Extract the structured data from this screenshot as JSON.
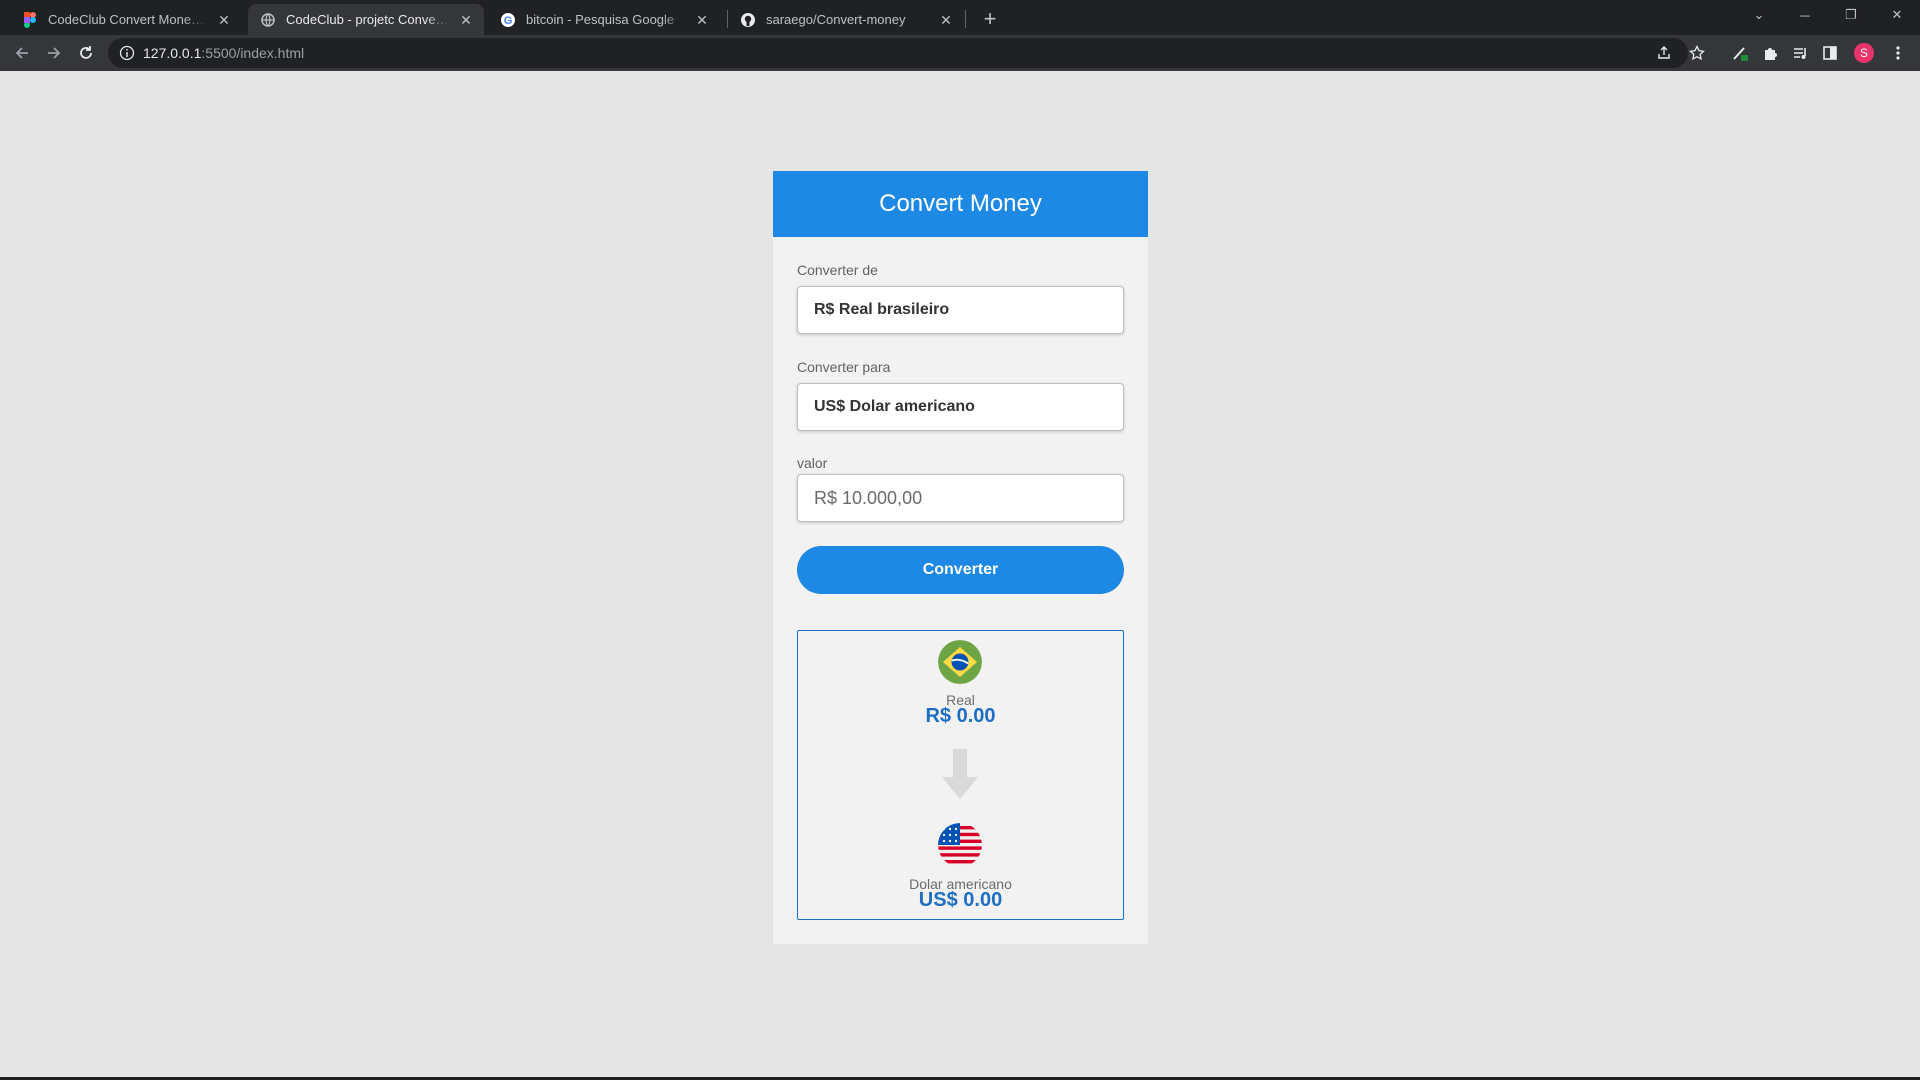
{
  "browser": {
    "tabs": [
      {
        "title": "CodeClub Convert Money – Figma",
        "icon": "figma-icon",
        "active": false
      },
      {
        "title": "CodeClub - projetc Convert Money",
        "icon": "globe-icon",
        "active": true
      },
      {
        "title": "bitcoin - Pesquisa Google",
        "icon": "google-icon",
        "active": false
      },
      {
        "title": "saraego/Convert-money",
        "icon": "github-icon",
        "active": false
      }
    ],
    "url_host": "127.0.0.1",
    "url_path": ":5500/index.html",
    "profile_initial": "S"
  },
  "app": {
    "title": "Convert Money",
    "from_label": "Converter de",
    "from_selected": "R$ Real brasileiro",
    "to_label": "Converter para",
    "to_selected": "US$ Dolar americano",
    "value_label": "valor",
    "value_placeholder": "R$ 10.000,00",
    "convert_button": "Converter",
    "result": {
      "from_currency_name": "Real",
      "from_value": "R$ 0.00",
      "to_currency_name": "Dolar americano",
      "to_value": "US$ 0.00"
    }
  },
  "colors": {
    "accent": "#1e88e5",
    "value_text": "#1e6fc4",
    "page_bg": "#e5e5e5",
    "card_bg": "#f2f2f2"
  }
}
